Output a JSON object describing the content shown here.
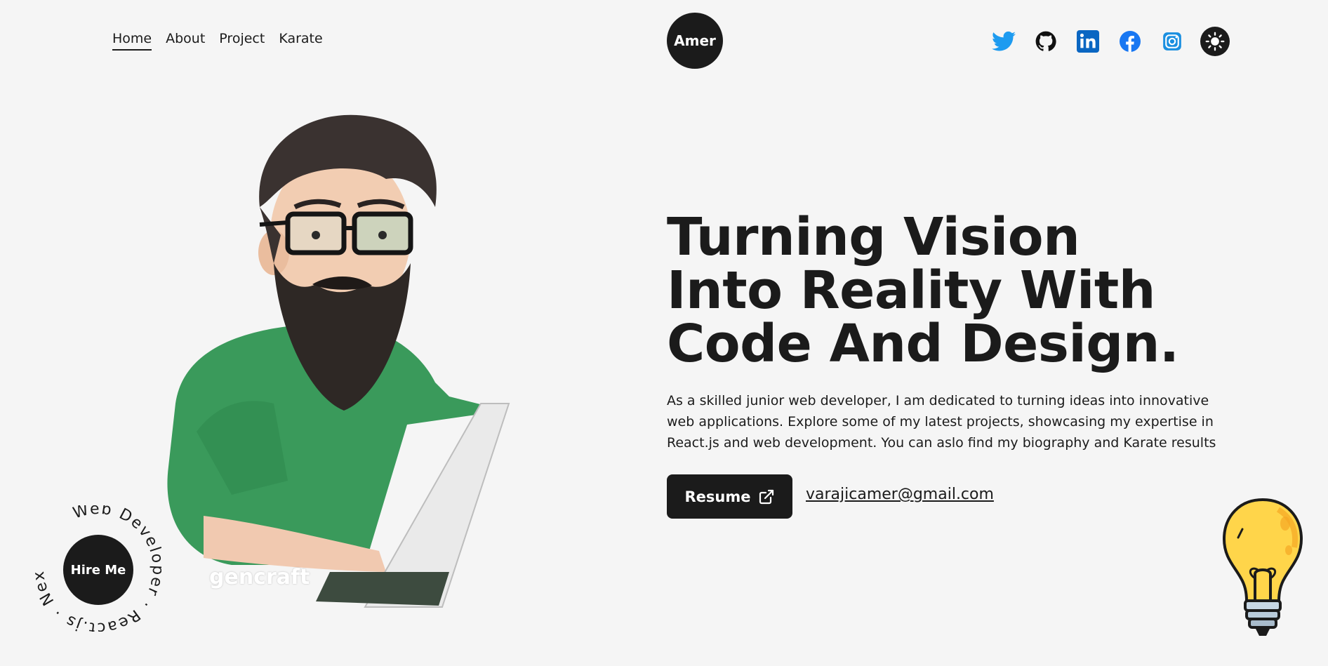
{
  "nav": {
    "links": [
      "Home",
      "About",
      "Project",
      "Karate"
    ],
    "active": "Home"
  },
  "logo": "Amer",
  "socials": [
    "twitter-icon",
    "github-icon",
    "linkedin-icon",
    "facebook-icon",
    "instagram-icon"
  ],
  "theme_toggle": "sun-icon",
  "hero": {
    "headline": "Turning Vision Into Reality With Code And Design.",
    "lead": "As a skilled junior web developer, I am dedicated to turning ideas into innovative web applications. Explore some of my latest projects, showcasing my expertise in React.js and web development. You can aslo find my biography and Karate results",
    "resume_label": "Resume",
    "email": "varajicamer@gmail.com"
  },
  "hire": {
    "label": "Hire Me",
    "ring_text": "Web Developer · React.js · Next.js · "
  },
  "watermark": "gencraft",
  "colors": {
    "background": "#f5f5f5",
    "dark": "#1b1b1b",
    "twitter": "#1d9bf0",
    "linkedin": "#0a66c2",
    "facebook": "#1877f2",
    "instagram": "#1a8fe0",
    "shirt": "#3a9a5b"
  }
}
